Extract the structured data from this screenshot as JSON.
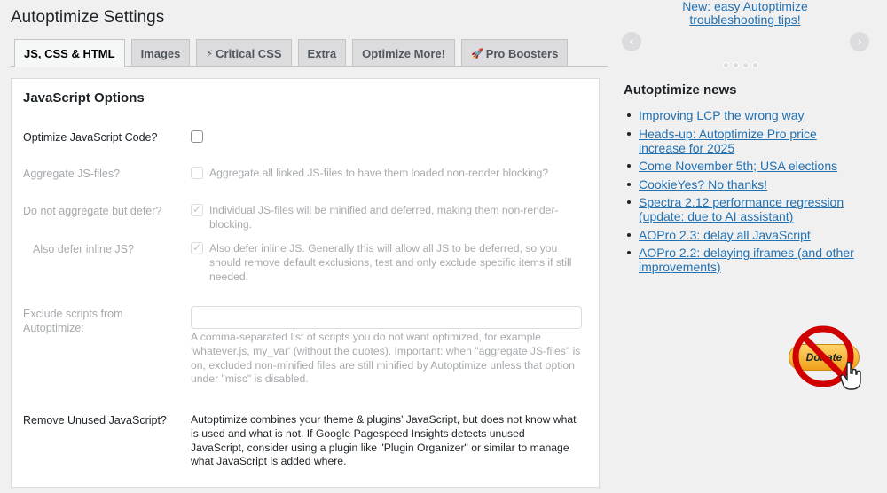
{
  "page": {
    "title": "Autoptimize Settings"
  },
  "tabs": [
    {
      "label": "JS, CSS & HTML",
      "icon": ""
    },
    {
      "label": "Images",
      "icon": ""
    },
    {
      "label": "Critical CSS",
      "icon": "⚡"
    },
    {
      "label": "Extra",
      "icon": ""
    },
    {
      "label": "Optimize More!",
      "icon": ""
    },
    {
      "label": "Pro Boosters",
      "icon": "🚀"
    }
  ],
  "js_options": {
    "title": "JavaScript Options",
    "optimize": {
      "label": "Optimize JavaScript Code?"
    },
    "aggregate": {
      "label": "Aggregate JS-files?",
      "desc": "Aggregate all linked JS-files to have them loaded non-render blocking?"
    },
    "defer": {
      "label": "Do not aggregate but defer?",
      "desc": "Individual JS-files will be minified and deferred, making them non-render-blocking."
    },
    "defer_inline": {
      "label": "Also defer inline JS?",
      "desc": "Also defer inline JS. Generally this will allow all JS to be deferred, so you should remove default exclusions, test and only exclude specific items if still needed."
    },
    "exclude": {
      "label": "Exclude scripts from Autoptimize:",
      "value": "",
      "desc": "A comma-separated list of scripts you do not want optimized, for example 'whatever.js, my_var' (without the quotes). Important: when \"aggregate JS-files\" is on, excluded non-minified files are still minified by Autoptimize unless that option under \"misc\" is disabled."
    },
    "unused": {
      "label": "Remove Unused JavaScript?",
      "desc": "Autoptimize combines your theme & plugins' JavaScript, but does not know what is used and what is not. If Google Pagespeed Insights detects unused JavaScript, consider using a plugin like \"Plugin Organizer\" or similar to manage what JavaScript is added where."
    }
  },
  "sidebar": {
    "tip_link": "New: easy Autoptimize troubleshooting tips!",
    "prev_label": "‹",
    "next_label": "›",
    "news_title": "Autoptimize news",
    "news": [
      "Improving LCP the wrong way",
      "Heads-up: Autoptimize Pro price increase for 2025",
      "Come November 5th; USA elections",
      "CookieYes? No thanks!",
      "Spectra 2.12 performance regression (update: due to AI assistant)",
      "AOPro 2.3: delay all JavaScript",
      "AOPro 2.2: delaying iframes (and other improvements)"
    ],
    "donate_label": "Donate"
  },
  "colors": {
    "link": "#2271b1",
    "accent_no": "#d00000"
  }
}
